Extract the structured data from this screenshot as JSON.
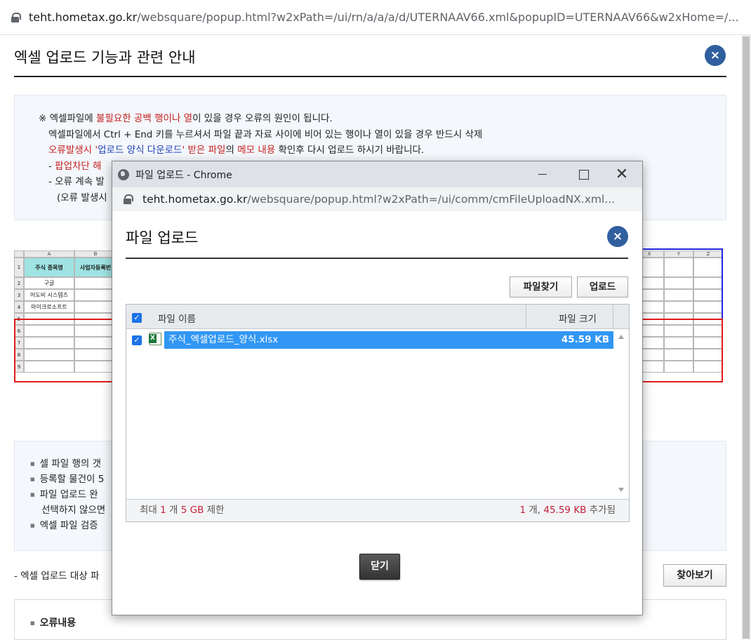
{
  "outer": {
    "url_host": "teht.hometax.go.kr",
    "url_path": "/websquare/popup.html?w2xPath=/ui/rn/a/a/a/d/UTERNAAV66.xml&popupID=UTERNAAV66&w2xHome=/...",
    "title": "엑셀 업로드 기능과 관련 안내",
    "close_symbol": "×",
    "notice": {
      "line1_prefix": "※ 엑셀파일에 ",
      "line1_red": "불필요한 공백 행이나 열",
      "line1_suffix": "이 있을 경우 오류의 원인이 됩니다.",
      "line2": "엑셀파일에서 Ctrl + End 키를 누르셔서 파일 끝과 자료 사이에 비어 있는 행이나 열이 있을 경우 반드시 삭제",
      "line3_red1": "오류발생시 '",
      "line3_blue": "업로드 양식 다운로드",
      "line3_red2": "' 받은 파일",
      "line3_mid": "의 ",
      "line3_red3": "메모 내용",
      "line3_suffix": " 확인후 다시 업로드 하시기 바랍니다.",
      "line4_prefix": "- ",
      "line4_red": "팝업차단 해",
      "line5": "- 오류 계속 발",
      "line6": "(오류 발생시"
    },
    "sheet": {
      "col_headers": [
        "A",
        "B",
        "X",
        "Y",
        "Z"
      ],
      "header_row": [
        "주식 종목명",
        "사업자등록번"
      ],
      "rows": [
        "구글",
        "어도비 시스템즈",
        "마이크로소프트"
      ],
      "row_numbers": [
        "1",
        "2",
        "3",
        "4",
        "5",
        "6",
        "7",
        "8",
        "9"
      ]
    },
    "info": {
      "item1": "셀 파일 행의 갯",
      "item2": "등록할 물건이 5",
      "item3": "파일 업로드 완",
      "item3_cont": "선택하지 않으면",
      "item4": "엑셀 파일 검증"
    },
    "target_label": "- 엑셀 업로드 대상 파",
    "browse_button": "찾아보기",
    "error_title": "오류내용"
  },
  "popup": {
    "window_title": "파일 업로드 - Chrome",
    "url_host": "teht.hometax.go.kr",
    "url_path": "/websquare/popup.html?w2xPath=/ui/comm/cmFileUploadNX.xml...",
    "title": "파일 업로드",
    "close_symbol": "×",
    "find_button": "파일찾기",
    "upload_button": "업로드",
    "grid": {
      "col_name": "파일 이름",
      "col_size": "파일 크기",
      "files": [
        {
          "name": "주식_엑셀업로드_양식.xlsx",
          "size": "45.59 KB",
          "checked": true
        }
      ],
      "footer_left_1": "최대 ",
      "footer_left_count": "1",
      "footer_left_2": " 개 ",
      "footer_left_limit": "5 GB",
      "footer_left_3": " 제한",
      "footer_right_count": "1",
      "footer_right_1": " 개, ",
      "footer_right_size": "45.59 KB",
      "footer_right_2": " 추가됨"
    },
    "close_button": "닫기"
  },
  "colors": {
    "accent_blue": "#2f5f9e",
    "selection_blue": "#3297f4",
    "emphasis_red": "#c51f1f",
    "link_blue": "#1e3fb5"
  }
}
